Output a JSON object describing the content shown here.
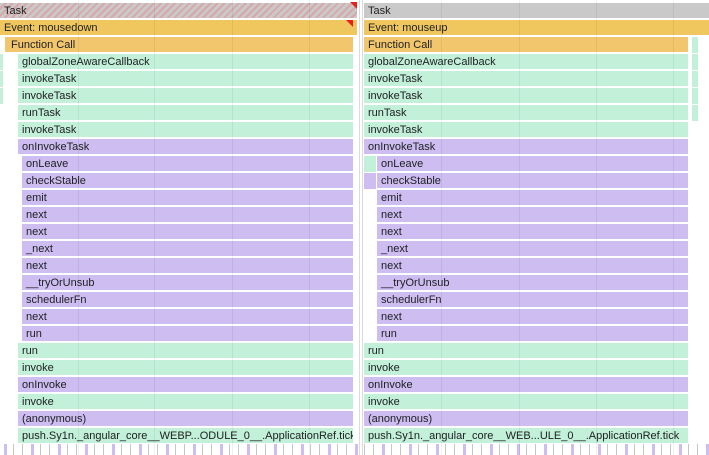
{
  "colors": {
    "task": "#c9c9c9",
    "event": "#f0c75e",
    "function_call": "#f2c66d",
    "green": "#c2f0d9",
    "purple": "#cdbdf1",
    "long_task_flag": "#e8201a"
  },
  "flame_left": {
    "task_label": "Task",
    "event_label": "Event: mousedown",
    "function_call_label": "Function Call",
    "frames": [
      {
        "label": "globalZoneAwareCallback",
        "color": "green"
      },
      {
        "label": "invokeTask",
        "color": "green"
      },
      {
        "label": "invokeTask",
        "color": "green"
      },
      {
        "label": "runTask",
        "color": "green"
      },
      {
        "label": "invokeTask",
        "color": "green"
      },
      {
        "label": "onInvokeTask",
        "color": "purple"
      },
      {
        "label": "onLeave",
        "color": "purple"
      },
      {
        "label": "checkStable",
        "color": "purple"
      },
      {
        "label": "emit",
        "color": "purple"
      },
      {
        "label": "next",
        "color": "purple"
      },
      {
        "label": "next",
        "color": "purple"
      },
      {
        "label": "_next",
        "color": "purple"
      },
      {
        "label": "next",
        "color": "purple"
      },
      {
        "label": "__tryOrUnsub",
        "color": "purple"
      },
      {
        "label": "schedulerFn",
        "color": "purple"
      },
      {
        "label": "next",
        "color": "purple"
      },
      {
        "label": "run",
        "color": "purple"
      },
      {
        "label": "run",
        "color": "green"
      },
      {
        "label": "invoke",
        "color": "green"
      },
      {
        "label": "onInvoke",
        "color": "purple"
      },
      {
        "label": "invoke",
        "color": "green"
      },
      {
        "label": "(anonymous)",
        "color": "purple"
      },
      {
        "label": "push.Sy1n._angular_core__WEBP...ODULE_0__.ApplicationRef.tick",
        "color": "green"
      }
    ]
  },
  "flame_right": {
    "task_label": "Task",
    "event_label": "Event: mouseup",
    "function_call_label": "Function Call",
    "frames": [
      {
        "label": "globalZoneAwareCallback",
        "color": "green"
      },
      {
        "label": "invokeTask",
        "color": "green"
      },
      {
        "label": "invokeTask",
        "color": "green"
      },
      {
        "label": "runTask",
        "color": "green"
      },
      {
        "label": "invokeTask",
        "color": "green"
      },
      {
        "label": "onInvokeTask",
        "color": "purple"
      },
      {
        "label": "onLeave",
        "color": "purple"
      },
      {
        "label": "checkStable",
        "color": "purple"
      },
      {
        "label": "emit",
        "color": "purple"
      },
      {
        "label": "next",
        "color": "purple"
      },
      {
        "label": "next",
        "color": "purple"
      },
      {
        "label": "_next",
        "color": "purple"
      },
      {
        "label": "next",
        "color": "purple"
      },
      {
        "label": "__tryOrUnsub",
        "color": "purple"
      },
      {
        "label": "schedulerFn",
        "color": "purple"
      },
      {
        "label": "next",
        "color": "purple"
      },
      {
        "label": "run",
        "color": "purple"
      },
      {
        "label": "run",
        "color": "green"
      },
      {
        "label": "invoke",
        "color": "green"
      },
      {
        "label": "onInvoke",
        "color": "purple"
      },
      {
        "label": "invoke",
        "color": "green"
      },
      {
        "label": "(anonymous)",
        "color": "purple"
      },
      {
        "label": "push.Sy1n._angular_core__WEB...ULE_0__.ApplicationRef.tick",
        "color": "green"
      }
    ]
  }
}
